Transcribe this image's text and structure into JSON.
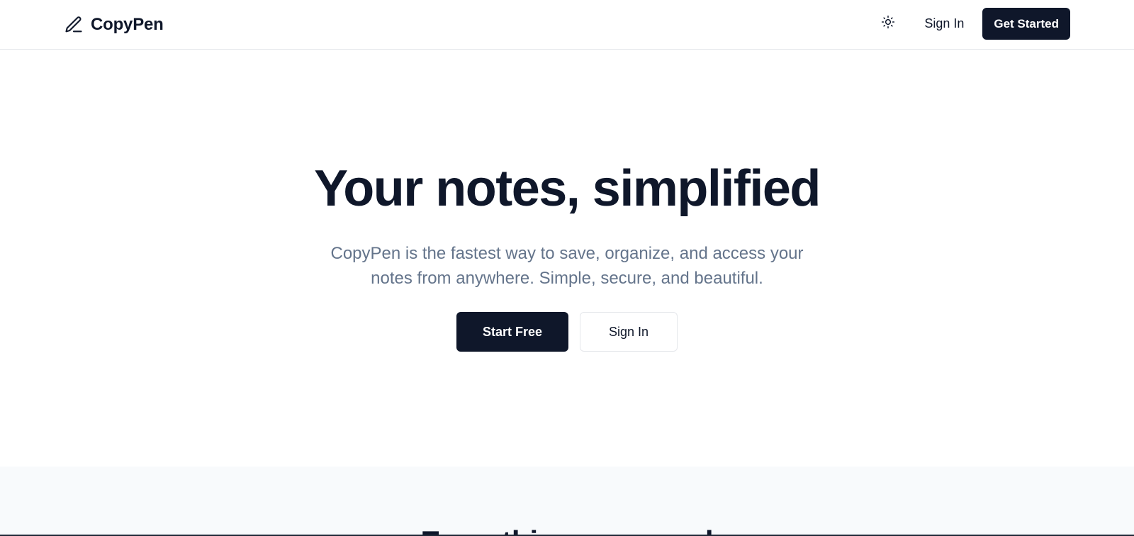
{
  "header": {
    "brand_name": "CopyPen",
    "brand_icon": "pen-icon",
    "theme_icon": "sun-icon",
    "sign_in_label": "Sign In",
    "get_started_label": "Get Started"
  },
  "hero": {
    "title": "Your notes, simplified",
    "subtitle": "CopyPen is the fastest way to save, organize, and access your notes from anywhere. Simple, secure, and beautiful.",
    "primary_button": "Start Free",
    "secondary_button": "Sign In"
  },
  "features": {
    "heading": "Everything you need"
  },
  "colors": {
    "primary": "#0f172a",
    "muted_text": "#64748b",
    "border": "#e5e7eb",
    "section_bg": "#f8fafc"
  }
}
